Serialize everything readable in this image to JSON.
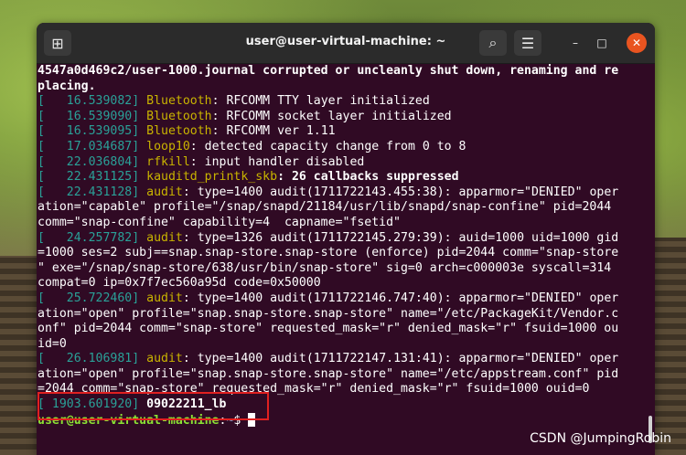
{
  "window": {
    "title": "user@user-virtual-machine: ~",
    "newtab_glyph": "⊞",
    "search_glyph": "⌕",
    "menu_glyph": "☰",
    "minimize_glyph": "–",
    "maximize_glyph": "□",
    "close_glyph": "✕"
  },
  "terminal": {
    "colors": {
      "background": "#300a24",
      "timestamp": "#2aa198",
      "facility": "#c9b400",
      "prompt_user": "#8ae234",
      "prompt_path": "#729fcf"
    },
    "lines": [
      {
        "type": "plain",
        "text": "4547a0d469c2/user-1000.journal corrupted or uncleanly shut down, renaming and re",
        "bold": true
      },
      {
        "type": "plain",
        "text": "placing.",
        "bold": true
      },
      {
        "type": "log",
        "ts": "16.539082",
        "fac": "Bluetooth",
        "msg": ": RFCOMM TTY layer initialized"
      },
      {
        "type": "log",
        "ts": "16.539090",
        "fac": "Bluetooth",
        "msg": ": RFCOMM socket layer initialized"
      },
      {
        "type": "log",
        "ts": "16.539095",
        "fac": "Bluetooth",
        "msg": ": RFCOMM ver 1.11"
      },
      {
        "type": "log",
        "ts": "17.034687",
        "fac": "loop10",
        "msg": ": detected capacity change from 0 to 8"
      },
      {
        "type": "log",
        "ts": "22.036804",
        "fac": "rfkill",
        "msg": ": input handler disabled"
      },
      {
        "type": "log",
        "ts": "22.431125",
        "fac": "kauditd_printk_skb",
        "msg": ": 26 callbacks suppressed",
        "bold": true
      },
      {
        "type": "log",
        "ts": "22.431128",
        "fac": "audit",
        "msg": ": type=1400 audit(1711722143.455:38): apparmor=\"DENIED\" oper"
      },
      {
        "type": "plain",
        "text": "ation=\"capable\" profile=\"/snap/snapd/21184/usr/lib/snapd/snap-confine\" pid=2044"
      },
      {
        "type": "plain",
        "text": "comm=\"snap-confine\" capability=4  capname=\"fsetid\""
      },
      {
        "type": "log",
        "ts": "24.257782",
        "fac": "audit",
        "msg": ": type=1326 audit(1711722145.279:39): auid=1000 uid=1000 gid"
      },
      {
        "type": "plain",
        "text": "=1000 ses=2 subj==snap.snap-store.snap-store (enforce) pid=2044 comm=\"snap-store"
      },
      {
        "type": "plain",
        "text": "\" exe=\"/snap/snap-store/638/usr/bin/snap-store\" sig=0 arch=c000003e syscall=314"
      },
      {
        "type": "plain",
        "text": "compat=0 ip=0x7f7ec560a95d code=0x50000"
      },
      {
        "type": "log",
        "ts": "25.722460",
        "fac": "audit",
        "msg": ": type=1400 audit(1711722146.747:40): apparmor=\"DENIED\" oper"
      },
      {
        "type": "plain",
        "text": "ation=\"open\" profile=\"snap.snap-store.snap-store\" name=\"/etc/PackageKit/Vendor.c"
      },
      {
        "type": "plain",
        "text": "onf\" pid=2044 comm=\"snap-store\" requested_mask=\"r\" denied_mask=\"r\" fsuid=1000 ou"
      },
      {
        "type": "plain",
        "text": "id=0"
      },
      {
        "type": "log",
        "ts": "26.106981",
        "fac": "audit",
        "msg": ": type=1400 audit(1711722147.131:41): apparmor=\"DENIED\" oper"
      },
      {
        "type": "plain",
        "text": "ation=\"open\" profile=\"snap.snap-store.snap-store\" name=\"/etc/appstream.conf\" pid"
      },
      {
        "type": "plain",
        "text": "=2044 comm=\"snap-store\" requested_mask=\"r\" denied_mask=\"r\" fsuid=1000 ouid=0"
      },
      {
        "type": "log",
        "ts": "1903.601920",
        "fac": "",
        "msg": "09022211_lb",
        "bold": true
      }
    ],
    "prompt": {
      "user": "user@user-virtual-machine",
      "sep": ":",
      "path": "~",
      "symbol": "$"
    }
  },
  "watermark": "CSDN @JumpingRobin"
}
